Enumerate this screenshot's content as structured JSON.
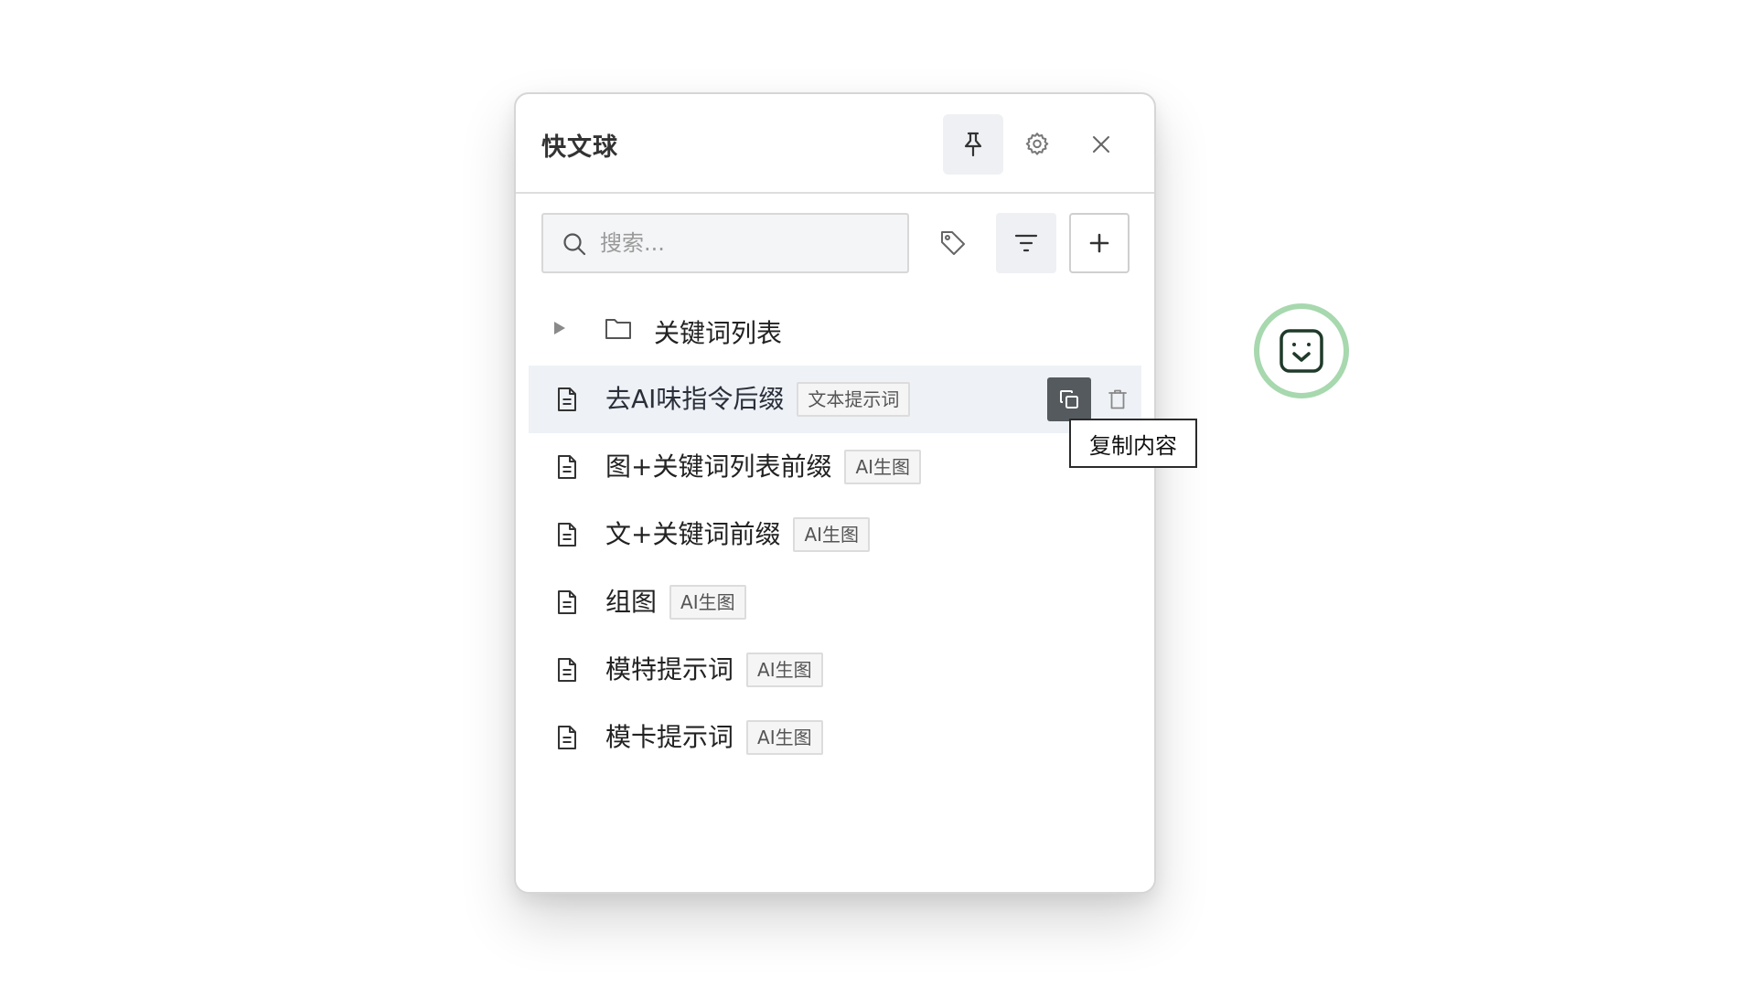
{
  "app": {
    "title": "快文球"
  },
  "header": {
    "pin_icon": "pin-icon",
    "settings_icon": "gear-icon",
    "close_icon": "close-icon"
  },
  "toolbar": {
    "search": {
      "placeholder": "搜索...",
      "value": ""
    },
    "tag_icon": "tag-icon",
    "filter_icon": "filter-icon",
    "add_icon": "plus-icon"
  },
  "tree": {
    "folder": {
      "label": "关键词列表",
      "expanded": false
    },
    "items": [
      {
        "label": "去AI味指令后缀",
        "tag": "文本提示词",
        "hovered": true
      },
      {
        "label": "图+关键词列表前缀",
        "tag": "AI生图",
        "hovered": false
      },
      {
        "label": "文+关键词前缀",
        "tag": "AI生图",
        "hovered": false
      },
      {
        "label": "组图",
        "tag": "AI生图",
        "hovered": false
      },
      {
        "label": "模特提示词",
        "tag": "AI生图",
        "hovered": false
      },
      {
        "label": "模卡提示词",
        "tag": "AI生图",
        "hovered": false
      }
    ]
  },
  "row_actions": {
    "copy_icon": "copy-icon",
    "delete_icon": "trash-icon"
  },
  "tooltip": {
    "text": "复制内容"
  },
  "floating_ball": {
    "icon": "smiley-face-icon",
    "accent": "#a7d8ae",
    "icon_color": "#1f3a2a"
  },
  "colors": {
    "hover_row": "#eef2f7",
    "copy_button_bg": "#555a5f",
    "active_button_bg": "#eef0f3"
  }
}
